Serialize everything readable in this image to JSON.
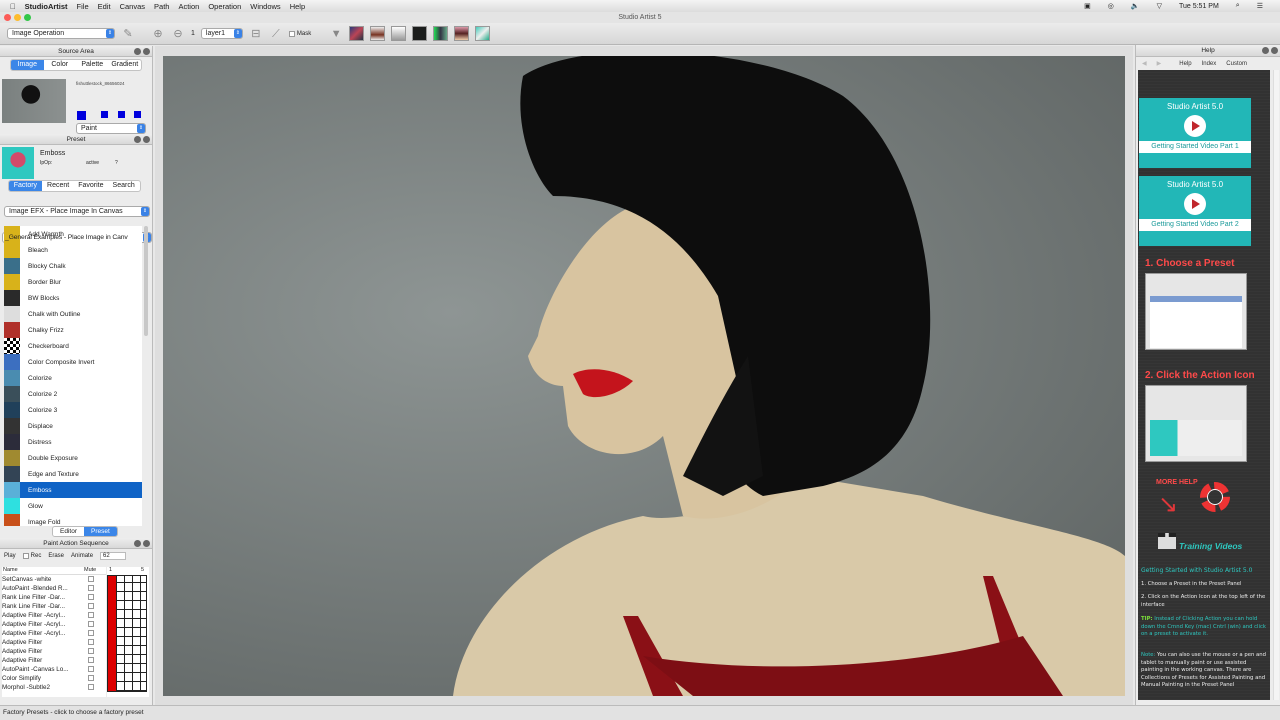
{
  "menubar": {
    "app": "StudioArtist",
    "items": [
      "File",
      "Edit",
      "Canvas",
      "Path",
      "Action",
      "Operation",
      "Windows",
      "Help"
    ],
    "clock": "Tue 5:51 PM"
  },
  "window_title": "Studio Artist 5",
  "toolbar": {
    "operation": "Image Operation",
    "layer_num": "1",
    "layer": "layer1",
    "mask_label": "Mask"
  },
  "source_area": {
    "title": "Source Area",
    "tabs": [
      "Image",
      "Color",
      "Palette",
      "Gradient"
    ],
    "active_tab": "Image",
    "filename": "fishuttlestock_86656024",
    "mode": "Paint"
  },
  "preset": {
    "title": "Preset",
    "name": "Emboss",
    "op_label": "IpOp:",
    "op_value": "active",
    "op_num": "?",
    "tabs": [
      "Factory",
      "Recent",
      "Favorite",
      "Search"
    ],
    "category": "Image EFX - Place Image In Canvas",
    "subcategory": "_General Examples - Place Image in Canv",
    "items": [
      "Add Warmth",
      "Bleach",
      "Blocky Chalk",
      "Border Blur",
      "BW Blocks",
      "Chalk with Outline",
      "Chalky Frizz",
      "Checkerboard",
      "Color Composite Invert",
      "Colorize",
      "Colorize 2",
      "Colorize 3",
      "Displace",
      "Distress",
      "Double Exposure",
      "Edge and Texture",
      "Emboss",
      "Glow",
      "Image Fold"
    ],
    "selected": "Emboss",
    "bottom_tabs": [
      "Editor",
      "Preset"
    ]
  },
  "pas": {
    "title": "Paint Action Sequence",
    "play": "Play",
    "rec": "Rec",
    "erase": "Erase",
    "animate": "Animate",
    "frames": "62",
    "col_name": "Name",
    "col_mute": "Mute",
    "grid_start": "1",
    "grid_mark": "5",
    "rows": [
      "SetCanvas -white",
      "AutoPaint -Blended R...",
      "Rank Line Filter -Dar...",
      "Rank Line Filter -Dar...",
      "Adaptive Filter -Acryl...",
      "Adaptive Filter -Acryl...",
      "Adaptive Filter -Acryl...",
      "Adaptive Filter",
      "Adaptive Filter",
      "Adaptive Filter",
      "AutoPaint -Canvas Lo...",
      "Color Simplify",
      "Morphol -Subtle2"
    ]
  },
  "help": {
    "title": "Help",
    "nav": [
      "Help",
      "Index",
      "Custom"
    ],
    "video1_title": "Studio Artist 5.0",
    "video1_cap": "Getting Started Video Part 1",
    "video2_title": "Studio Artist 5.0",
    "video2_cap": "Getting Started Video Part 2",
    "step1": "1. Choose a Preset",
    "step2": "2. Click the Action Icon",
    "more_help": "MORE HELP",
    "training": "Training Videos",
    "heading": "Getting Started with Studio Artist 5.0",
    "p1": "1. Choose a Preset in the Preset Panel",
    "p2": "2. Click on the Action Icon at the top left of the interface",
    "tip_label": "TIP:",
    "tip": "Instead of Clicking Action you can hold down the Cmnd Key (mac) Cntrl (win) and click on a preset to activate it.",
    "note_label": "Note:",
    "note": "You can also use the mouse or a pen and tablet to manually paint or use assisted painting in the working canvas. There are Collections of Presets for Assisted Painting and Manual Painting in the Preset Panel"
  },
  "status": "Factory Presets - click to choose a factory preset",
  "colors": {
    "accent": "#3b86e8",
    "selection": "#0f63c6",
    "teal": "#22b7b7",
    "red": "#e1373a"
  }
}
